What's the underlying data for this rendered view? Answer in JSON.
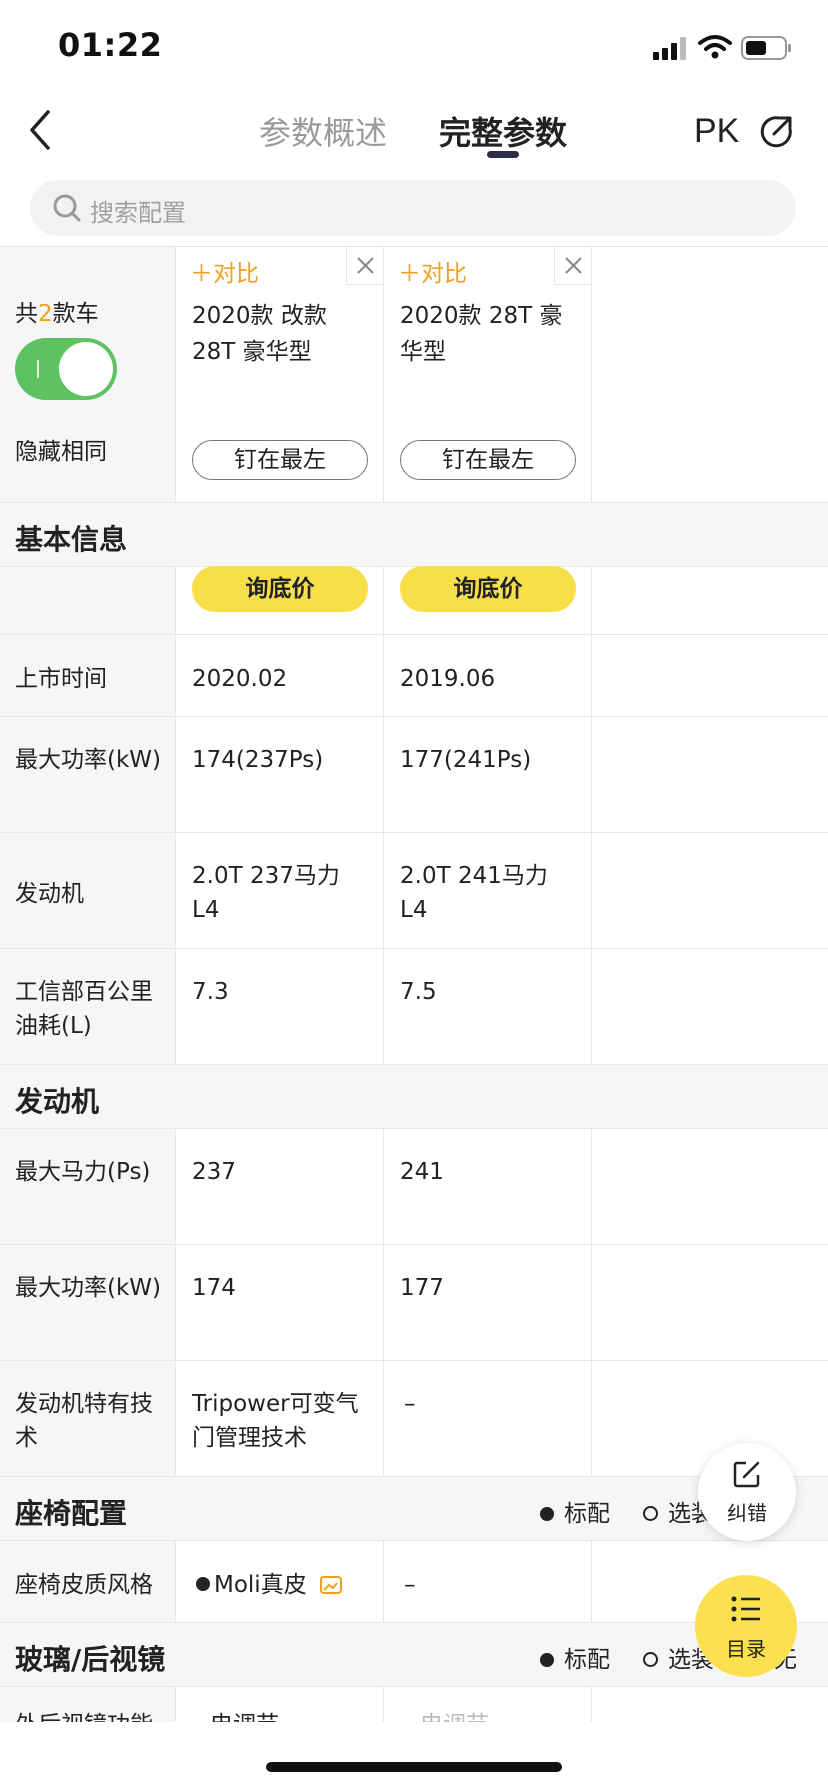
{
  "status": {
    "time": "01:22"
  },
  "nav": {
    "tabs": [
      "参数概述",
      "完整参数"
    ],
    "active_tab": 1,
    "pk_label": "PK"
  },
  "search": {
    "placeholder": "搜索配置"
  },
  "header": {
    "count_prefix": "共",
    "count": "2",
    "count_suffix": "款车",
    "hide_same_label": "隐藏相同",
    "hide_same_on": true
  },
  "cars": [
    {
      "compare_label": "＋对比",
      "name": "2020款 改款 28T 豪华型",
      "pin_label": "钉在最左"
    },
    {
      "compare_label": "＋对比",
      "name": "2020款 28T 豪华型",
      "pin_label": "钉在最左"
    }
  ],
  "sections": {
    "basic_title": "基本信息",
    "price_btn": "询底价",
    "engine_title": "发动机",
    "seat_title": "座椅配置",
    "glass_title": "玻璃/后视镜"
  },
  "rows": {
    "launch": {
      "label": "上市时间",
      "values": [
        "2020.02",
        "2019.06"
      ]
    },
    "max_power": {
      "label": "最大功率(kW)",
      "values": [
        "174(237Ps)",
        "177(241Ps)"
      ]
    },
    "engine": {
      "label": "发动机",
      "values": [
        "2.0T 237马力 L4",
        "2.0T 241马力 L4"
      ]
    },
    "fuel": {
      "label": "工信部百公里油耗(L)",
      "values": [
        "7.3",
        "7.5"
      ]
    },
    "max_hp": {
      "label": "最大马力(Ps)",
      "values": [
        "237",
        "241"
      ]
    },
    "max_kw": {
      "label": "最大功率(kW)",
      "values": [
        "174",
        "177"
      ]
    },
    "engine_tech": {
      "label": "发动机特有技术",
      "values": [
        "Tripower可变气门管理技术",
        "–"
      ]
    },
    "seat_material": {
      "label": "座椅皮质风格",
      "values": [
        "Moli真皮",
        "–"
      ]
    },
    "mirror_partial": {
      "label": "外后视镜功能",
      "values": [
        "电调节",
        "电调节"
      ]
    }
  },
  "legend": {
    "standard": "标配",
    "optional": "选装",
    "none": "无"
  },
  "fab": {
    "correct_label": "纠错",
    "catalog_label": "目录"
  },
  "colors": {
    "accent_orange": "#f0a020",
    "toggle_green": "#5dc25f",
    "price_yellow": "#f7df4a",
    "fab_yellow": "#fbe14f"
  }
}
